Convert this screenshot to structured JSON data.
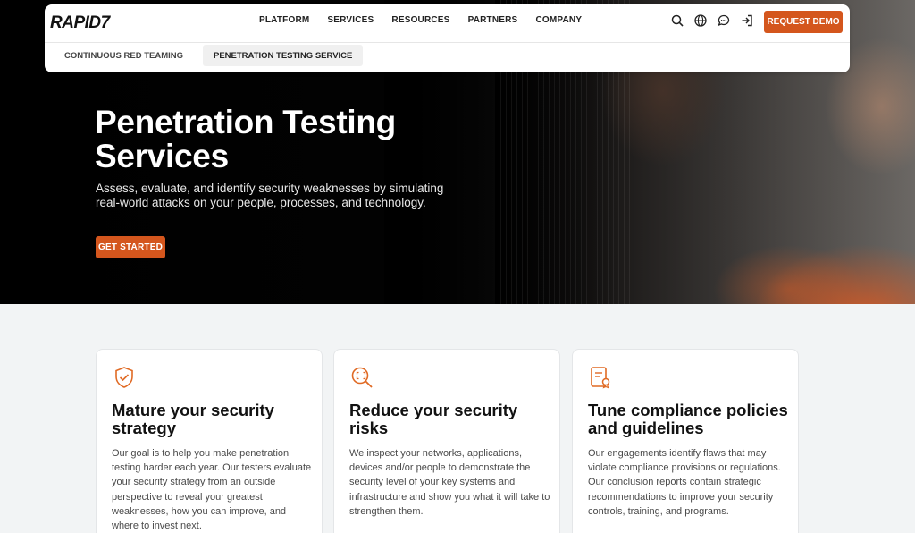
{
  "nav": {
    "logo_text": "RAPID7",
    "menu": [
      "PLATFORM",
      "SERVICES",
      "RESOURCES",
      "PARTNERS",
      "COMPANY"
    ],
    "icons": [
      "search-icon",
      "globe-icon",
      "chat-icon",
      "sign-in-icon"
    ],
    "demo_button": "REQUEST DEMO",
    "subnav": [
      "CONTINUOUS RED TEAMING",
      "PENETRATION TESTING SERVICE"
    ],
    "active_subnav": "PENETRATION TESTING SERVICE"
  },
  "hero": {
    "title": "Penetration Testing Services",
    "subtitle": "Assess, evaluate, and identify security weaknesses by simulating real-world attacks on your people, processes, and technology.",
    "cta": "GET STARTED"
  },
  "cards": [
    {
      "icon": "shield-check-icon",
      "title": "Mature your security strategy",
      "body": "Our goal is to help you make penetration testing harder each year. Our testers evaluate your security strategy from an outside perspective to reveal your greatest weaknesses, how you can improve, and where to invest next."
    },
    {
      "icon": "magnifier-risk-icon",
      "title": "Reduce your security risks",
      "body": "We inspect your networks, applications, devices and/or people to demonstrate the security level of your key systems and infrastructure and show you what it will take to strengthen them."
    },
    {
      "icon": "certificate-icon",
      "title": "Tune compliance policies and guidelines",
      "body": "Our engagements identify flaws that may violate compliance provisions or regulations. Our conclusion reports contain strategic recommendations to improve your security controls, training, and programs."
    }
  ],
  "colors": {
    "accent": "#d4561d",
    "icon_accent": "#e06a24"
  }
}
